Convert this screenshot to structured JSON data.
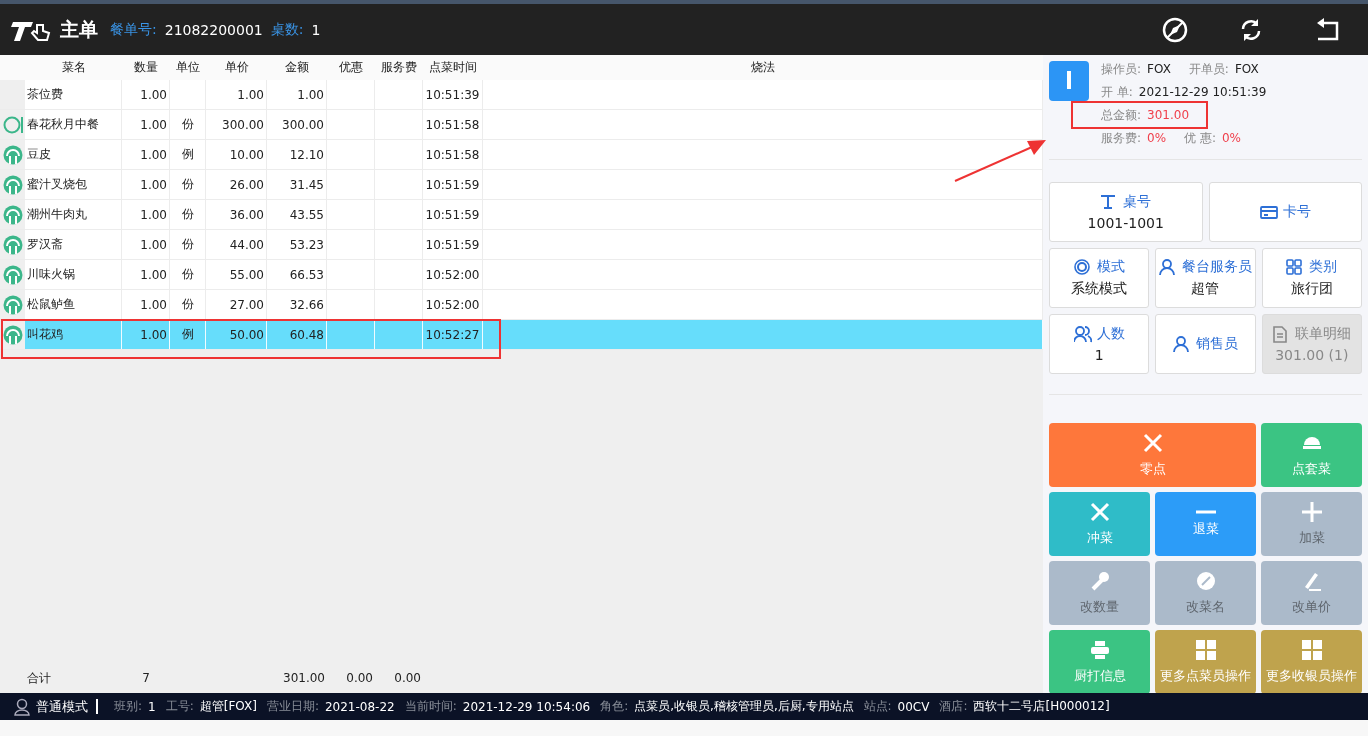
{
  "header": {
    "title": "主单",
    "order_label": "餐单号:",
    "order_no": "21082200001",
    "tables_label": "桌数:",
    "tables": "1"
  },
  "table": {
    "columns": [
      "菜名",
      "数量",
      "单位",
      "单价",
      "金额",
      "优惠",
      "服务费",
      "点菜时间",
      "烧法"
    ],
    "rows": [
      {
        "kind": "plain",
        "selected": false,
        "cells": [
          "茶位费",
          "1.00",
          "",
          "1.00",
          "1.00",
          "",
          "",
          "10:51:39",
          ""
        ]
      },
      {
        "kind": "set",
        "selected": false,
        "cells": [
          "春花秋月中餐",
          "1.00",
          "份",
          "300.00",
          "300.00",
          "",
          "",
          "10:51:58",
          ""
        ]
      },
      {
        "kind": "dish",
        "selected": false,
        "cells": [
          "豆皮",
          "1.00",
          "例",
          "10.00",
          "12.10",
          "",
          "",
          "10:51:58",
          ""
        ]
      },
      {
        "kind": "dish",
        "selected": false,
        "cells": [
          "蜜汁叉烧包",
          "1.00",
          "份",
          "26.00",
          "31.45",
          "",
          "",
          "10:51:59",
          ""
        ]
      },
      {
        "kind": "dish",
        "selected": false,
        "cells": [
          "潮州牛肉丸",
          "1.00",
          "份",
          "36.00",
          "43.55",
          "",
          "",
          "10:51:59",
          ""
        ]
      },
      {
        "kind": "dish",
        "selected": false,
        "cells": [
          "罗汉斋",
          "1.00",
          "份",
          "44.00",
          "53.23",
          "",
          "",
          "10:51:59",
          ""
        ]
      },
      {
        "kind": "dish",
        "selected": false,
        "cells": [
          "川味火锅",
          "1.00",
          "份",
          "55.00",
          "66.53",
          "",
          "",
          "10:52:00",
          ""
        ]
      },
      {
        "kind": "dish",
        "selected": false,
        "cells": [
          "松鼠鲈鱼",
          "1.00",
          "份",
          "27.00",
          "32.66",
          "",
          "",
          "10:52:00",
          ""
        ]
      },
      {
        "kind": "dish",
        "selected": true,
        "cells": [
          "叫花鸡",
          "1.00",
          "例",
          "50.00",
          "60.48",
          "",
          "",
          "10:52:27",
          ""
        ]
      }
    ],
    "totals": {
      "label": "合计",
      "quantity": "7",
      "amount": "301.00",
      "discount": "0.00",
      "service": "0.00"
    }
  },
  "info": {
    "lines": [
      [
        {
          "label": "操作员:",
          "value": "FOX",
          "alert": false
        },
        {
          "label": "开单员:",
          "value": "FOX",
          "alert": false
        }
      ],
      [
        {
          "label": "开  单:",
          "value": "2021-12-29 10:51:39",
          "alert": false
        }
      ],
      [
        {
          "label": "总金额:",
          "value": "301.00",
          "alert": true
        }
      ],
      [
        {
          "label": "服务费:",
          "value": "0%",
          "alert": true
        },
        {
          "label": "优  惠:",
          "value": "0%",
          "alert": true
        }
      ]
    ]
  },
  "fields": [
    {
      "label": "桌号",
      "value": "1001-1001",
      "wide": true,
      "disabled": false
    },
    {
      "label": "卡号",
      "wide": true,
      "disabled": false
    },
    {
      "label": "模式",
      "value": "系统模式",
      "wide": false,
      "disabled": false
    },
    {
      "label": "餐台服务员",
      "value": "超管",
      "wide": false,
      "disabled": false
    },
    {
      "label": "类别",
      "value": "旅行团",
      "wide": false,
      "disabled": false
    },
    {
      "label": "人数",
      "value": "1",
      "wide": false,
      "disabled": false
    },
    {
      "label": "销售员",
      "wide": false,
      "disabled": false
    },
    {
      "label": "联单明细",
      "value": "301.00 (1)",
      "wide": false,
      "disabled": true
    }
  ],
  "actions": [
    {
      "label": "零点",
      "color": "#fe773b",
      "wide": true,
      "disabled": false
    },
    {
      "label": "点套菜",
      "color": "#3bc483",
      "wide": false,
      "disabled": false
    },
    {
      "label": "冲菜",
      "color": "#2fbcc8",
      "wide": false,
      "disabled": false
    },
    {
      "label": "退菜",
      "color": "#2c9cf8",
      "wide": false,
      "disabled": false
    },
    {
      "label": "加菜",
      "color": "#abbaca",
      "wide": false,
      "disabled": true
    },
    {
      "label": "改数量",
      "color": "#abbaca",
      "wide": false,
      "disabled": true
    },
    {
      "label": "改菜名",
      "color": "#abbaca",
      "wide": false,
      "disabled": true
    },
    {
      "label": "改单价",
      "color": "#abbaca",
      "wide": false,
      "disabled": true
    },
    {
      "label": "厨打信息",
      "color": "#3bc483",
      "wide": false,
      "disabled": false
    },
    {
      "label": "更多点菜员操作",
      "color": "#bfa34d",
      "wide": false,
      "disabled": false
    },
    {
      "label": "更多收银员操作",
      "color": "#bfa34d",
      "wide": false,
      "disabled": false
    }
  ],
  "status_bar": {
    "mode": "普通模式",
    "items": [
      {
        "label": "班别:",
        "value": "1"
      },
      {
        "label": "工号:",
        "value": "超管[FOX]"
      },
      {
        "label": "营业日期:",
        "value": "2021-08-22"
      },
      {
        "label": "当前时间:",
        "value": "2021-12-29 10:54:06"
      },
      {
        "label": "角色:",
        "value": "点菜员,收银员,稽核管理员,后厨,专用站点"
      },
      {
        "label": "站点:",
        "value": "00CV"
      },
      {
        "label": "酒店:",
        "value": "西软十二号店[H000012]"
      }
    ]
  }
}
